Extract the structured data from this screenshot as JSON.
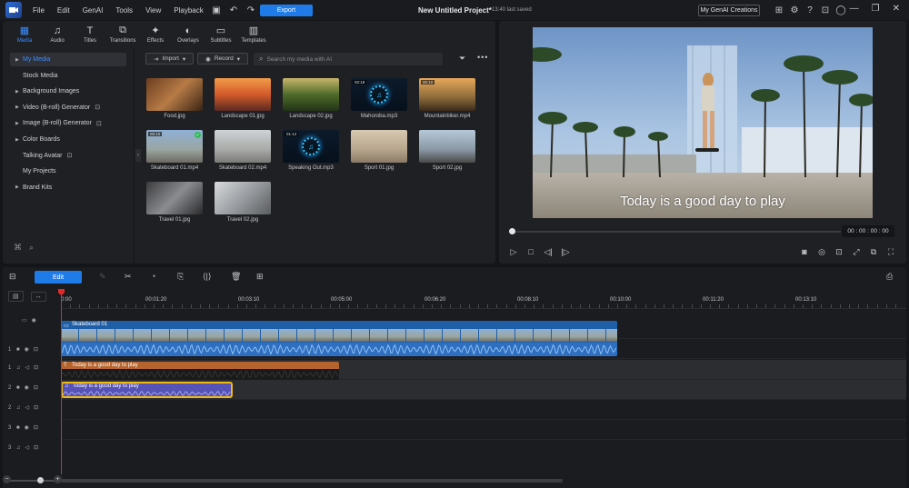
{
  "titlebar": {
    "menu": [
      "File",
      "Edit",
      "GenAI",
      "Tools",
      "View",
      "Playback"
    ],
    "export_label": "Export",
    "project_title": "New Untitled Project*",
    "saved_status": "13:40 last saved",
    "genai_button": "My GenAI Creations"
  },
  "tabs": [
    {
      "label": "Media",
      "icon": "media-icon",
      "active": true
    },
    {
      "label": "Audio",
      "icon": "music-note-icon"
    },
    {
      "label": "Titles",
      "icon": "title-t-icon"
    },
    {
      "label": "Transitions",
      "icon": "transition-icon"
    },
    {
      "label": "Effects",
      "icon": "effects-icon"
    },
    {
      "label": "Overlays",
      "icon": "overlays-icon"
    },
    {
      "label": "Subtitles",
      "icon": "subtitles-icon"
    },
    {
      "label": "Templates",
      "icon": "templates-icon"
    }
  ],
  "sidebar": {
    "items": [
      {
        "label": "My Media",
        "arrow": true,
        "active": true
      },
      {
        "label": "Stock Media",
        "arrow": false
      },
      {
        "label": "Background Images",
        "arrow": true
      },
      {
        "label": "Video (B-roll) Generator",
        "arrow": true,
        "badge": true
      },
      {
        "label": "Image (B-roll) Generator",
        "arrow": true,
        "badge": true
      },
      {
        "label": "Color Boards",
        "arrow": true
      },
      {
        "label": "Talking Avatar",
        "arrow": false,
        "badge": true
      },
      {
        "label": "My Projects",
        "arrow": false
      },
      {
        "label": "Brand Kits",
        "arrow": true
      }
    ]
  },
  "media_toolbar": {
    "import_label": "Import",
    "record_label": "Record",
    "search_placeholder": "Search my media with AI"
  },
  "media": [
    {
      "name": "Food.jpg",
      "kind": "food"
    },
    {
      "name": "Landscape 01.jpg",
      "kind": "sunset"
    },
    {
      "name": "Landscape 02.jpg",
      "kind": "forest"
    },
    {
      "name": "Mahoroba.mp3",
      "kind": "audio",
      "duration": "02:19"
    },
    {
      "name": "Mountainbiker.mp4",
      "kind": "mtb",
      "duration": "00:10"
    },
    {
      "name": "Skateboard 01.mp4",
      "kind": "skate1",
      "duration": "00:10",
      "checked": true
    },
    {
      "name": "Skateboard 02.mp4",
      "kind": "skate2"
    },
    {
      "name": "Speaking Out.mp3",
      "kind": "audio",
      "duration": "01:14"
    },
    {
      "name": "Sport 01.jpg",
      "kind": "sport1"
    },
    {
      "name": "Sport 02.jpg",
      "kind": "sport2"
    },
    {
      "name": "Travel 01.jpg",
      "kind": "travel1"
    },
    {
      "name": "Travel 02.jpg",
      "kind": "travel2"
    }
  ],
  "preview": {
    "subtitle": "Today is a good day to play",
    "timecode": "00 : 00 : 00 : 00"
  },
  "timeline": {
    "edit_label": "Edit",
    "ruler_labels": [
      "0:00",
      "00:01:20",
      "00:03:10",
      "00:05:00",
      "00:06:20",
      "00:08:10",
      "00:10:00",
      "00:11:20",
      "00:13:10"
    ],
    "clips": {
      "video": "Skateboard 01",
      "title": "Today is a good day to play",
      "audio": "Today is a good day to play"
    },
    "track_numbers": [
      "1",
      "1",
      "2",
      "2",
      "3",
      "3"
    ]
  },
  "colors": {
    "accent": "#1e7be8",
    "active_tab": "#3c8dff",
    "video_clip": "#1f5fa8",
    "title_clip": "#b5642d",
    "audio_clip": "#5653b8",
    "selection": "#f2b90f",
    "playhead": "#e12a2a"
  }
}
